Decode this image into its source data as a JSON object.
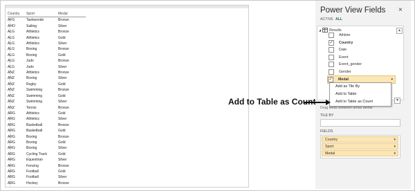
{
  "table": {
    "headers": [
      "Country",
      "Sport",
      "Medal"
    ],
    "rows": [
      [
        "AFG",
        "Taekwondo",
        "Bronze"
      ],
      [
        "AHO",
        "Sailing",
        "Silver"
      ],
      [
        "ALG",
        "Athletics",
        "Bronze"
      ],
      [
        "ALG",
        "Athletics",
        "Gold"
      ],
      [
        "ALG",
        "Athletics",
        "Silver"
      ],
      [
        "ALG",
        "Boxing",
        "Bronze"
      ],
      [
        "ALG",
        "Boxing",
        "Gold"
      ],
      [
        "ALG",
        "Judo",
        "Bronze"
      ],
      [
        "ALG",
        "Judo",
        "Silver"
      ],
      [
        "ANZ",
        "Athletics",
        "Bronze"
      ],
      [
        "ANZ",
        "Boxing",
        "Silver"
      ],
      [
        "ANZ",
        "Rugby",
        "Gold"
      ],
      [
        "ANZ",
        "Swimming",
        "Bronze"
      ],
      [
        "ANZ",
        "Swimming",
        "Gold"
      ],
      [
        "ANZ",
        "Swimming",
        "Silver"
      ],
      [
        "ANZ",
        "Tennis",
        "Bronze"
      ],
      [
        "ARG",
        "Athletics",
        "Gold"
      ],
      [
        "ARG",
        "Athletics",
        "Silver"
      ],
      [
        "ARG",
        "Basketball",
        "Bronze"
      ],
      [
        "ARG",
        "Basketball",
        "Gold"
      ],
      [
        "ARG",
        "Boxing",
        "Bronze"
      ],
      [
        "ARG",
        "Boxing",
        "Gold"
      ],
      [
        "ARG",
        "Boxing",
        "Silver"
      ],
      [
        "ARG",
        "Cycling Track",
        "Gold"
      ],
      [
        "ARG",
        "Equestrian",
        "Silver"
      ],
      [
        "ARG",
        "Fencing",
        "Bronze"
      ],
      [
        "ARG",
        "Football",
        "Gold"
      ],
      [
        "ARG",
        "Football",
        "Silver"
      ],
      [
        "ARG",
        "Hockey",
        "Bronze"
      ]
    ]
  },
  "pane": {
    "title": "Power View Fields",
    "close_icon": "×",
    "tabs": {
      "active": "ACTIVE",
      "all": "ALL"
    },
    "table_name": "Results",
    "fields": [
      {
        "label": "Athlete",
        "checked": false,
        "bold": false
      },
      {
        "label": "Country",
        "checked": true,
        "bold": true
      },
      {
        "label": "Date",
        "checked": false,
        "bold": false
      },
      {
        "label": "Event",
        "checked": false,
        "bold": false
      },
      {
        "label": "Event_gender",
        "checked": false,
        "bold": false
      },
      {
        "label": "Gender",
        "checked": false,
        "bold": false
      },
      {
        "label": "Medal",
        "checked": true,
        "bold": true
      }
    ],
    "context_menu": [
      "Add as Tile By",
      "Add to Table",
      "Add to Table as Count"
    ],
    "drag_hint": "Drag fields between areas below:",
    "tile_by_label": "TILE BY",
    "fields_label": "FIELDS",
    "field_wells": [
      "Country",
      "Sport",
      "Medal"
    ],
    "check_mark": "✓",
    "dropdown_glyph": "▾",
    "scroll_up": "▲",
    "scroll_down": "▼"
  },
  "annotation": {
    "text": "Add to Table as Count"
  },
  "colors": {
    "accent": "#217346",
    "field_highlight": "#fce6b4"
  }
}
